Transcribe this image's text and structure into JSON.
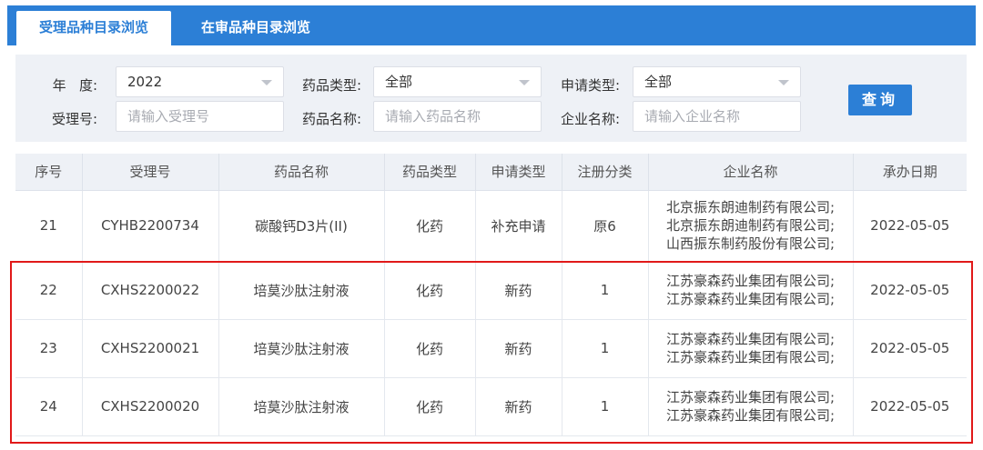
{
  "tabs": [
    {
      "label": "受理品种目录浏览",
      "active": true
    },
    {
      "label": "在审品种目录浏览",
      "active": false
    }
  ],
  "filters": {
    "year": {
      "label": "年   度:",
      "value": "2022"
    },
    "drug_type": {
      "label": "药品类型:",
      "value": "全部"
    },
    "apply_type": {
      "label": "申请类型:",
      "value": "全部"
    },
    "accept_no": {
      "label": "受理号:",
      "placeholder": "请输入受理号"
    },
    "drug_name": {
      "label": "药品名称:",
      "placeholder": "请输入药品名称"
    },
    "company": {
      "label": "企业名称:",
      "placeholder": "请输入企业名称"
    },
    "search_label": "查询"
  },
  "table": {
    "headers": [
      "序号",
      "受理号",
      "药品名称",
      "药品类型",
      "申请类型",
      "注册分类",
      "企业名称",
      "承办日期"
    ],
    "rows": [
      {
        "no": "21",
        "accept": "CYHB2200734",
        "name": "碳酸钙D3片(II)",
        "dtype": "化药",
        "atype": "补充申请",
        "cls": "原6",
        "companies": [
          "北京振东朗迪制药有限公司;",
          "北京振东朗迪制药有限公司;",
          "山西振东制药股份有限公司;"
        ],
        "date": "2022-05-05"
      },
      {
        "no": "22",
        "accept": "CXHS2200022",
        "name": "培莫沙肽注射液",
        "dtype": "化药",
        "atype": "新药",
        "cls": "1",
        "companies": [
          "江苏豪森药业集团有限公司;",
          "江苏豪森药业集团有限公司;"
        ],
        "date": "2022-05-05"
      },
      {
        "no": "23",
        "accept": "CXHS2200021",
        "name": "培莫沙肽注射液",
        "dtype": "化药",
        "atype": "新药",
        "cls": "1",
        "companies": [
          "江苏豪森药业集团有限公司;",
          "江苏豪森药业集团有限公司;"
        ],
        "date": "2022-05-05"
      },
      {
        "no": "24",
        "accept": "CXHS2200020",
        "name": "培莫沙肽注射液",
        "dtype": "化药",
        "atype": "新药",
        "cls": "1",
        "companies": [
          "江苏豪森药业集团有限公司;",
          "江苏豪森药业集团有限公司;"
        ],
        "date": "2022-05-05"
      }
    ]
  },
  "colors": {
    "accent": "#2c7fd6",
    "highlight": "#e11919",
    "header_bg": "#eef1f6"
  }
}
